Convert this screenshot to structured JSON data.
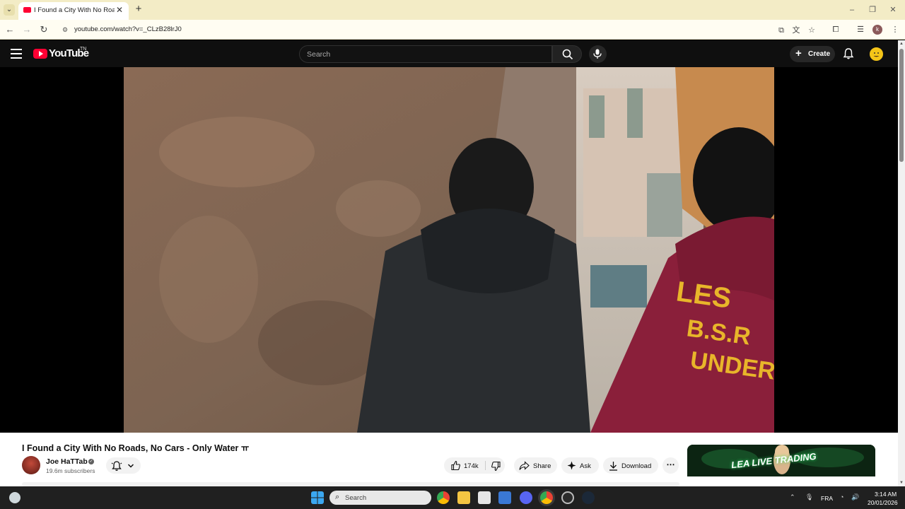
{
  "browser": {
    "tab_title": "I Found a City With No Roads, No Cars - Only Water",
    "url": "youtube.com/watch?v=_CLzB28lrJ0"
  },
  "youtube": {
    "logo_text": "YouTube",
    "logo_tm": "TN",
    "search_placeholder": "Search",
    "create_label": "Create"
  },
  "video": {
    "title": "I Found a City With No Roads, No Cars - Only Water ㅠ",
    "channel_name": "Joe HaTTab",
    "subscribers": "19.6m subscribers",
    "likes": "174k",
    "share_label": "Share",
    "ask_label": "Ask",
    "download_label": "Download"
  },
  "ad": {
    "text": "LEA LIVE TRADING"
  },
  "taskbar": {
    "search_text": "Search",
    "language": "FRA",
    "time": "3:14 AM",
    "date": "20/01/2026"
  },
  "colors": {
    "youtube_red": "#ff0033",
    "masthead_bg": "#0f0f0f",
    "tab_strip_bg": "#f3ecc6"
  },
  "icons": [
    "hamburger-icon",
    "search-icon",
    "mic-icon",
    "bell-icon",
    "like-icon",
    "dislike-icon",
    "share-icon",
    "sparkle-icon",
    "download-icon",
    "notification-bell-icon",
    "chevron-down-icon",
    "windows-start-icon"
  ]
}
